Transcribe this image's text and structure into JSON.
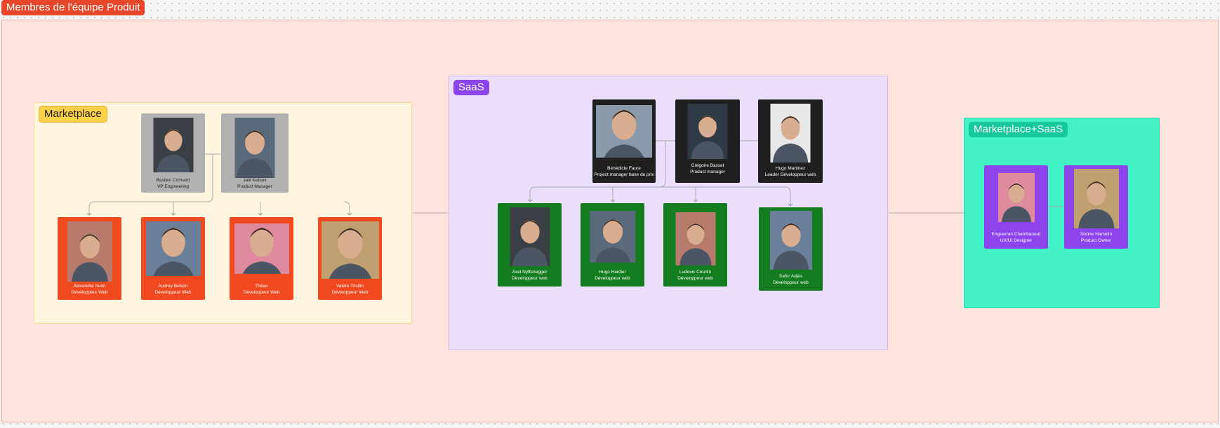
{
  "frame": {
    "title": "Membres de l'équipe Produit"
  },
  "groups": {
    "marketplace": {
      "label": "Marketplace"
    },
    "saas": {
      "label": "SaaS"
    },
    "marketplace_saas": {
      "label": "Marketplace+SaaS"
    }
  },
  "marketplace": {
    "leads": [
      {
        "name": "Bastien Colmard",
        "role": "VP Engineering"
      },
      {
        "name": "Jalil Kettani",
        "role": "Product Manager"
      }
    ],
    "devs": [
      {
        "name": "Alexandre Surin",
        "role": "Développeur Web"
      },
      {
        "name": "Audrey Belson",
        "role": "Développeur Web"
      },
      {
        "name": "Théau",
        "role": "Développeur Web"
      },
      {
        "name": "Valère Tristlin",
        "role": "Développeur Web"
      }
    ]
  },
  "saas": {
    "leads": [
      {
        "name": "Bénédicte Faure",
        "role": "Project manager base de prix"
      },
      {
        "name": "Grégoire Basset",
        "role": "Product manager"
      },
      {
        "name": "Hugo Martinez",
        "role": "Leader Développeur web"
      }
    ],
    "devs": [
      {
        "name": "Axel Nyffenegger",
        "role": "Développeur web"
      },
      {
        "name": "Hugo Hardier",
        "role": "Développeur web"
      },
      {
        "name": "Ludovic Courtin",
        "role": "Développeur web"
      },
      {
        "name": "Safor Adjès",
        "role": "Développeur web"
      }
    ]
  },
  "marketplace_saas": {
    "members": [
      {
        "name": "Enguerran Chambaraud",
        "role": "UX/UI Designer"
      },
      {
        "name": "Sixtine Hamelin",
        "role": "Product Owner"
      }
    ]
  },
  "colors": {
    "frame_bg": "#ffe3dd",
    "frame_title": "#e8462a",
    "marketplace_bg": "#fff5de",
    "saas_bg": "#ecdffd",
    "marketplace_saas_bg": "#44f2c8",
    "card_grey": "#b1b1b1",
    "card_orange": "#f0481f",
    "card_dark": "#1f1f1f",
    "card_green": "#127c1f",
    "card_purple": "#8e44ec"
  }
}
